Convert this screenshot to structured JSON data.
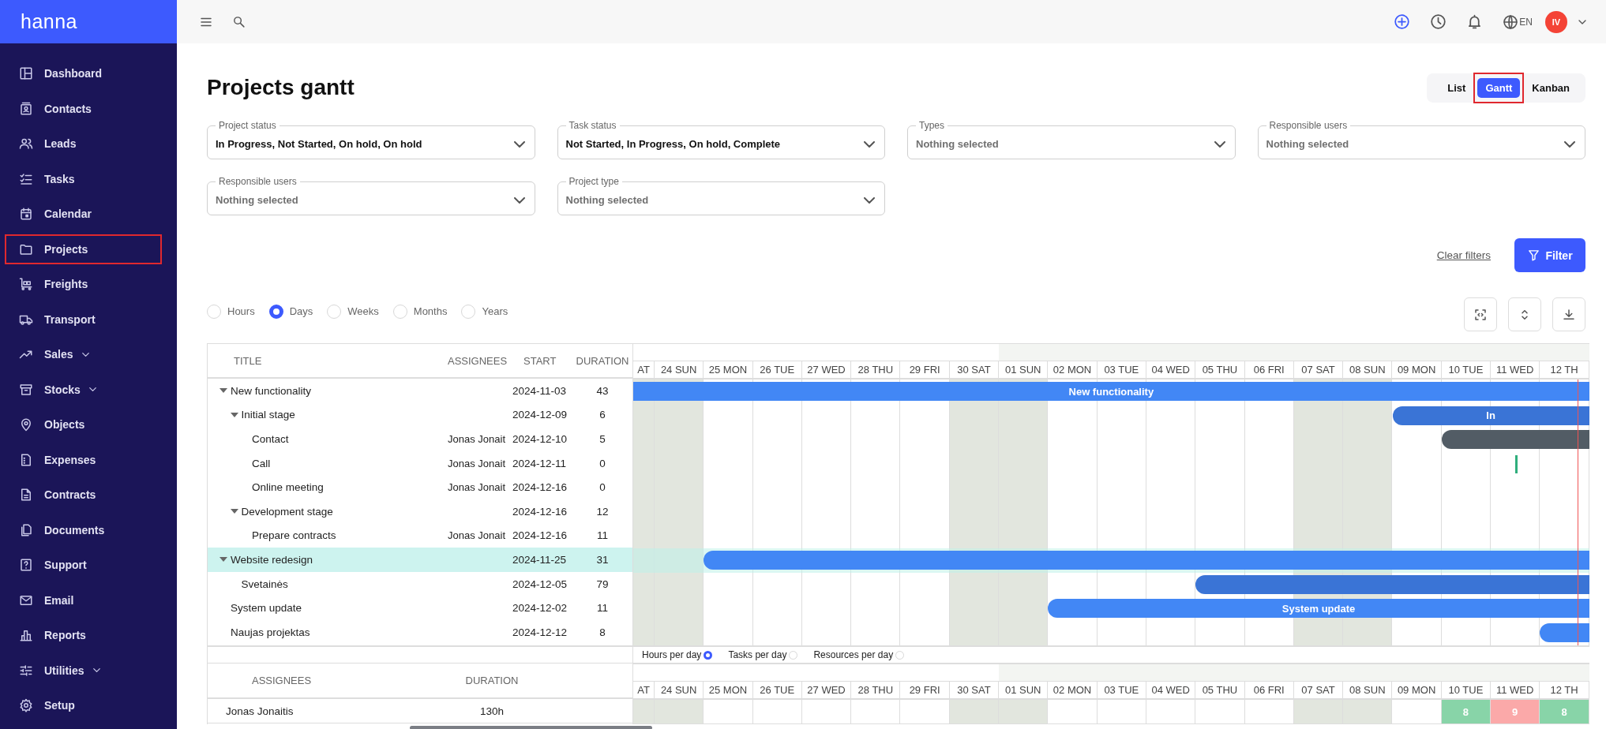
{
  "sidebar": {
    "logo": "hanna",
    "items": [
      {
        "label": "Dashboard",
        "expandable": false,
        "selected": false
      },
      {
        "label": "Contacts",
        "expandable": false,
        "selected": false
      },
      {
        "label": "Leads",
        "expandable": false,
        "selected": false
      },
      {
        "label": "Tasks",
        "expandable": false,
        "selected": false
      },
      {
        "label": "Calendar",
        "expandable": false,
        "selected": false
      },
      {
        "label": "Projects",
        "expandable": false,
        "selected": true
      },
      {
        "label": "Freights",
        "expandable": false,
        "selected": false
      },
      {
        "label": "Transport",
        "expandable": false,
        "selected": false
      },
      {
        "label": "Sales",
        "expandable": true,
        "selected": false
      },
      {
        "label": "Stocks",
        "expandable": true,
        "selected": false
      },
      {
        "label": "Objects",
        "expandable": false,
        "selected": false
      },
      {
        "label": "Expenses",
        "expandable": false,
        "selected": false
      },
      {
        "label": "Contracts",
        "expandable": false,
        "selected": false
      },
      {
        "label": "Documents",
        "expandable": false,
        "selected": false
      },
      {
        "label": "Support",
        "expandable": false,
        "selected": false
      },
      {
        "label": "Email",
        "expandable": false,
        "selected": false
      },
      {
        "label": "Reports",
        "expandable": false,
        "selected": false
      },
      {
        "label": "Utilities",
        "expandable": true,
        "selected": false
      },
      {
        "label": "Setup",
        "expandable": false,
        "selected": false
      }
    ]
  },
  "topbar": {
    "language": "EN",
    "avatar": "IV"
  },
  "page": {
    "title": "Projects gantt",
    "views": [
      {
        "label": "List",
        "selected": false
      },
      {
        "label": "Gantt",
        "selected": true
      },
      {
        "label": "Kanban",
        "selected": false
      }
    ]
  },
  "filters": [
    {
      "label": "Project status",
      "value": "In Progress, Not Started, On hold, On hold"
    },
    {
      "label": "Task status",
      "value": "Not Started, In Progress, On hold, Complete"
    },
    {
      "label": "Types",
      "placeholder": "Nothing selected"
    },
    {
      "label": "Responsible users",
      "placeholder": "Nothing selected"
    },
    {
      "label": "Responsible users",
      "placeholder": "Nothing selected"
    },
    {
      "label": "Project type",
      "placeholder": "Nothing selected"
    }
  ],
  "filter_actions": {
    "clear": "Clear filters",
    "apply": "Filter"
  },
  "scales": [
    {
      "label": "Hours",
      "selected": false
    },
    {
      "label": "Days",
      "selected": true
    },
    {
      "label": "Weeks",
      "selected": false
    },
    {
      "label": "Months",
      "selected": false
    },
    {
      "label": "Years",
      "selected": false
    }
  ],
  "gantt": {
    "columns": [
      "TITLE",
      "ASSIGNEES",
      "START",
      "DURATION"
    ],
    "days": [
      {
        "label": "AT",
        "weekend": true
      },
      {
        "label": "24 SUN",
        "weekend": true
      },
      {
        "label": "25 MON",
        "weekend": false
      },
      {
        "label": "26 TUE",
        "weekend": false
      },
      {
        "label": "27 WED",
        "weekend": false
      },
      {
        "label": "28 THU",
        "weekend": false
      },
      {
        "label": "29 FRI",
        "weekend": false
      },
      {
        "label": "30 SAT",
        "weekend": true
      },
      {
        "label": "01 SUN",
        "weekend": true
      },
      {
        "label": "02 MON",
        "weekend": false
      },
      {
        "label": "03 TUE",
        "weekend": false
      },
      {
        "label": "04 WED",
        "weekend": false
      },
      {
        "label": "05 THU",
        "weekend": false
      },
      {
        "label": "06 FRI",
        "weekend": false
      },
      {
        "label": "07 SAT",
        "weekend": true
      },
      {
        "label": "08 SUN",
        "weekend": true
      },
      {
        "label": "09 MON",
        "weekend": false
      },
      {
        "label": "10 TUE",
        "weekend": false
      },
      {
        "label": "11 WED",
        "weekend": false
      },
      {
        "label": "12 TH",
        "weekend": false
      }
    ],
    "rows": [
      {
        "title": "New functionality",
        "kind": "project",
        "start": "2024-11-03",
        "duration": "43",
        "bar_label": "New functionality",
        "expanded": true,
        "selected": false,
        "children": [
          {
            "title": "Initial stage",
            "kind": "stage",
            "start": "2024-12-09",
            "duration": "6",
            "bar_label": "In",
            "expanded": true,
            "selected": false,
            "children": [
              {
                "title": "Contact",
                "kind": "task",
                "assignees": "Jonas Jonait",
                "start": "2024-12-10",
                "duration": "5",
                "selected": false
              },
              {
                "title": "Call",
                "kind": "milestone",
                "assignees": "Jonas Jonait",
                "start": "2024-12-11",
                "duration": "0",
                "selected": false
              },
              {
                "title": "Online meeting",
                "kind": "milestone",
                "assignees": "Jonas Jonait",
                "start": "2024-12-16",
                "duration": "0",
                "selected": false
              }
            ]
          },
          {
            "title": "Development stage",
            "kind": "stage",
            "start": "2024-12-16",
            "duration": "12",
            "expanded": true,
            "selected": false,
            "children": [
              {
                "title": "Prepare contracts",
                "kind": "task",
                "assignees": "Jonas Jonait",
                "start": "2024-12-16",
                "duration": "11",
                "selected": false
              }
            ]
          }
        ]
      },
      {
        "title": "Website redesign",
        "kind": "project",
        "start": "2024-11-25",
        "duration": "31",
        "expanded": true,
        "selected": true,
        "children": [
          {
            "title": "Svetainės",
            "kind": "stage",
            "start": "2024-12-05",
            "duration": "79",
            "selected": false
          }
        ]
      },
      {
        "title": "System update",
        "kind": "project",
        "start": "2024-12-02",
        "duration": "11",
        "bar_label": "System update",
        "selected": false
      },
      {
        "title": "Naujas projektas",
        "kind": "project",
        "start": "2024-12-12",
        "duration": "8",
        "selected": false
      }
    ]
  },
  "resources": {
    "options": [
      {
        "label": "Hours per day",
        "selected": true
      },
      {
        "label": "Tasks per day",
        "selected": false
      },
      {
        "label": "Resources per day",
        "selected": false
      }
    ],
    "columns": [
      "ASSIGNEES",
      "DURATION"
    ],
    "days": [
      {
        "label": "AT",
        "weekend": true
      },
      {
        "label": "24 SUN",
        "weekend": true
      },
      {
        "label": "25 MON",
        "weekend": false
      },
      {
        "label": "26 TUE",
        "weekend": false
      },
      {
        "label": "27 WED",
        "weekend": false
      },
      {
        "label": "28 THU",
        "weekend": false
      },
      {
        "label": "29 FRI",
        "weekend": false
      },
      {
        "label": "30 SAT",
        "weekend": true
      },
      {
        "label": "01 SUN",
        "weekend": true
      },
      {
        "label": "02 MON",
        "weekend": false
      },
      {
        "label": "03 TUE",
        "weekend": false
      },
      {
        "label": "04 WED",
        "weekend": false
      },
      {
        "label": "05 THU",
        "weekend": false
      },
      {
        "label": "06 FRI",
        "weekend": false
      },
      {
        "label": "07 SAT",
        "weekend": true
      },
      {
        "label": "08 SUN",
        "weekend": true
      },
      {
        "label": "09 MON",
        "weekend": false
      },
      {
        "label": "10 TUE",
        "weekend": false,
        "load": "8",
        "color": "#88d4a8"
      },
      {
        "label": "11 WED",
        "weekend": false,
        "load": "9",
        "color": "#fba9a9"
      },
      {
        "label": "12 TH",
        "weekend": false,
        "load": "8",
        "color": "#88d4a8"
      }
    ],
    "rows": [
      {
        "name": "Jonas Jonaitis",
        "duration": "130h"
      }
    ]
  }
}
